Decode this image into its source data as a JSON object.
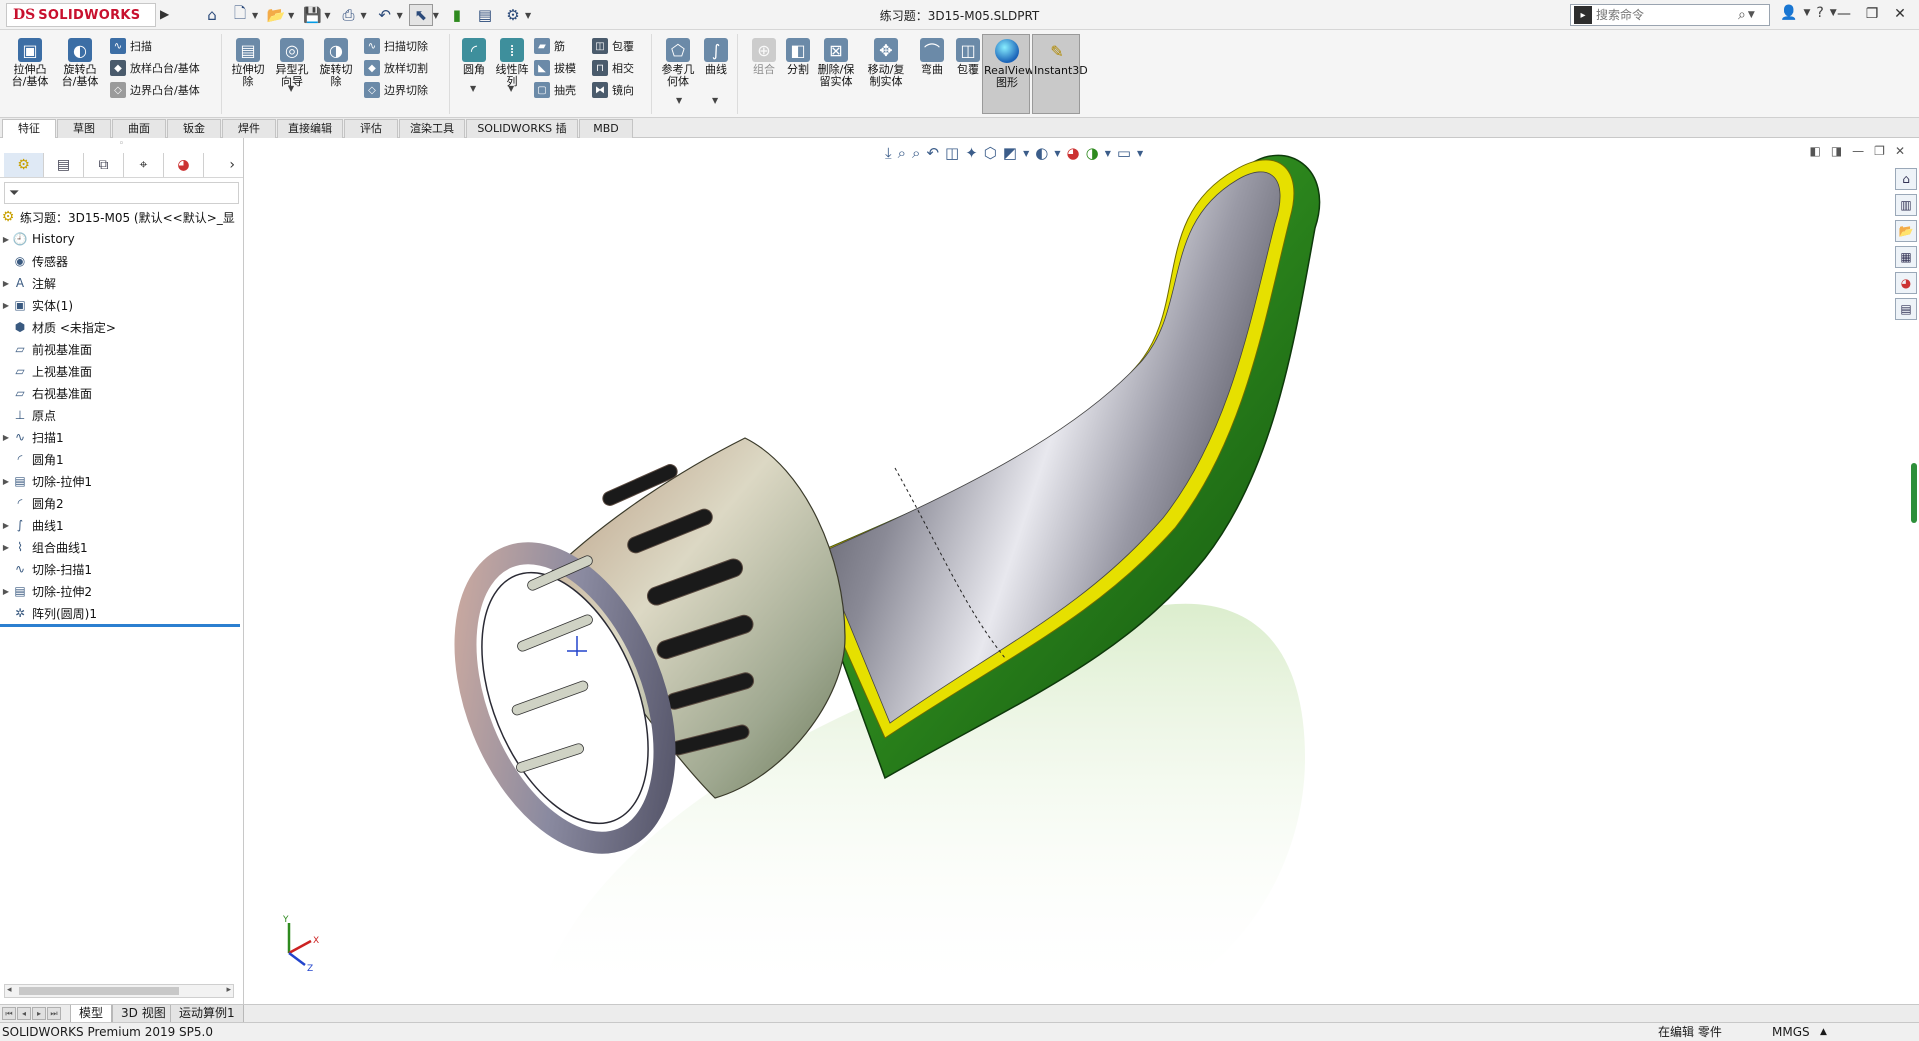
{
  "titlebar": {
    "brand": "SOLIDWORKS",
    "brand_mark": "DS",
    "document_title": "练习题：3D15-M05.SLDPRT",
    "search_placeholder": "搜索命令",
    "quick_tools": [
      "home-icon",
      "new-icon",
      "open-icon",
      "save-icon",
      "print-icon",
      "undo-icon",
      "select-icon",
      "traffic-light-icon",
      "options-icon",
      "gear-icon"
    ]
  },
  "ribbon": {
    "extrude_boss": "拉伸凸台/基体",
    "revolve_boss": "旋转凸台/基体",
    "sweep": "扫描",
    "loft_boss": "放样凸台/基体",
    "boundary_boss": "边界凸台/基体",
    "extrude_cut": "拉伸切除",
    "hole_wizard": "异型孔向导",
    "revolve_cut": "旋转切除",
    "swept_cut": "扫描切除",
    "lofted_cut": "放样切割",
    "boundary_cut": "边界切除",
    "fillet": "圆角",
    "linear_pattern": "线性阵列",
    "rib": "筋",
    "draft": "拔模",
    "shell": "抽壳",
    "wrap": "包覆",
    "intersect": "相交",
    "mirror": "镜向",
    "ref_geometry": "参考几何体",
    "curves": "曲线",
    "combine": "组合",
    "split": "分割",
    "delete_keep_body": "删除/保留实体",
    "move_copy_body": "移动/复制实体",
    "flex": "弯曲",
    "wrap2": "包覆",
    "realview": "RealView图形",
    "instant3d": "Instant3D"
  },
  "cm_tabs": [
    "特征",
    "草图",
    "曲面",
    "钣金",
    "焊件",
    "直接编辑",
    "评估",
    "渲染工具",
    "SOLIDWORKS 插件",
    "MBD"
  ],
  "feature_tree": {
    "root": "练习题：3D15-M05 (默认<<默认>_显",
    "items": [
      {
        "label": "History",
        "icon": "history-icon",
        "expand": true
      },
      {
        "label": "传感器",
        "icon": "sensor-icon",
        "expand": false
      },
      {
        "label": "注解",
        "icon": "annotation-icon",
        "expand": true
      },
      {
        "label": "实体(1)",
        "icon": "solid-bodies-icon",
        "expand": true
      },
      {
        "label": "材质 <未指定>",
        "icon": "material-icon",
        "expand": false
      },
      {
        "label": "前视基准面",
        "icon": "plane-icon",
        "expand": false
      },
      {
        "label": "上视基准面",
        "icon": "plane-icon",
        "expand": false
      },
      {
        "label": "右视基准面",
        "icon": "plane-icon",
        "expand": false
      },
      {
        "label": "原点",
        "icon": "origin-icon",
        "expand": false
      },
      {
        "label": "扫描1",
        "icon": "sweep-icon",
        "expand": true
      },
      {
        "label": "圆角1",
        "icon": "fillet-icon",
        "expand": false
      },
      {
        "label": "切除-拉伸1",
        "icon": "cut-extrude-icon",
        "expand": true
      },
      {
        "label": "圆角2",
        "icon": "fillet-icon",
        "expand": false
      },
      {
        "label": "曲线1",
        "icon": "curve-icon",
        "expand": true
      },
      {
        "label": "组合曲线1",
        "icon": "composite-curve-icon",
        "expand": true
      },
      {
        "label": "切除-扫描1",
        "icon": "cut-sweep-icon",
        "expand": false
      },
      {
        "label": "切除-拉伸2",
        "icon": "cut-extrude-icon",
        "expand": true
      },
      {
        "label": "阵列(圆周)1",
        "icon": "circular-pattern-icon",
        "expand": false
      }
    ]
  },
  "bottom_tabs": [
    "模型",
    "3D 视图",
    "运动算例1"
  ],
  "status": {
    "product": "SOLIDWORKS Premium 2019 SP5.0",
    "editing": "在编辑 零件",
    "units": "MMGS"
  },
  "triad": {
    "x": "X",
    "y": "Y",
    "z": "Z"
  },
  "colors": {
    "brand": "#c8102e",
    "accent": "#2b7fd0",
    "shell_outer": "#2e8a1e",
    "shell_edge": "#e6e000"
  }
}
